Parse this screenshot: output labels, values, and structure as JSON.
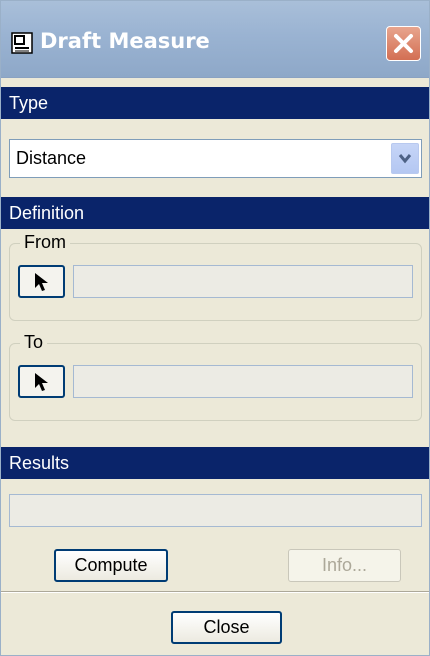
{
  "window": {
    "title": "Draft Measure",
    "icon": "draft-measure-icon"
  },
  "type_section": {
    "label": "Type",
    "selected": "Distance",
    "dropdown_icon": "chevron-down-icon"
  },
  "definition_section": {
    "label": "Definition",
    "from": {
      "label": "From",
      "pick_icon": "cursor-arrow-icon",
      "value": ""
    },
    "to": {
      "label": "To",
      "pick_icon": "cursor-arrow-icon",
      "value": ""
    }
  },
  "results_section": {
    "label": "Results",
    "value": ""
  },
  "buttons": {
    "compute": "Compute",
    "info": "Info...",
    "close": "Close"
  },
  "colors": {
    "section_bar": "#0a246a",
    "dialog_bg": "#ece9d8",
    "button_border": "#003c74"
  }
}
